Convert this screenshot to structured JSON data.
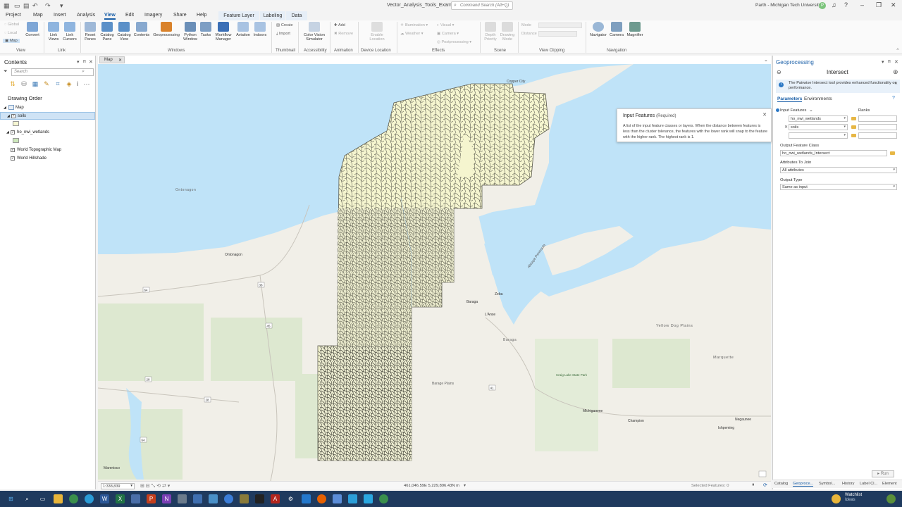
{
  "titlebar": {
    "doc_title": "Vector_Analysis_Tools_Examples",
    "search_placeholder": "Command Search (Alt+Q)",
    "user": "Parth - Michigan Tech University",
    "avatar_initial": "P"
  },
  "menu_tabs": [
    "Project",
    "Map",
    "Insert",
    "Analysis",
    "View",
    "Edit",
    "Imagery",
    "Share",
    "Help"
  ],
  "active_tab": "View",
  "context_tabs": [
    "Feature Layer",
    "Labeling",
    "Data"
  ],
  "ribbon": {
    "view_group": {
      "global": "Global",
      "local": "Local",
      "map": "Map",
      "convert": "Convert",
      "label": "View"
    },
    "link_group": {
      "link_views": "Link Views",
      "link_cursors": "Link Cursors",
      "label": "Link"
    },
    "windows_group": {
      "items": [
        "Reset Panes",
        "Catalog Pane",
        "Catalog View",
        "Contents",
        "Geoprocessing",
        "Python Window",
        "Tasks",
        "Workflow Manager",
        "Aviation",
        "Indoors"
      ],
      "label": "Windows"
    },
    "thumbnail_group": {
      "create": "Create",
      "import": "Import",
      "label": "Thumbnail"
    },
    "accessibility_group": {
      "item": "Color Vision Simulator",
      "label": "Accessibility"
    },
    "animation_group": {
      "add": "Add",
      "remove": "Remove",
      "label": "Animation"
    },
    "device_location_group": {
      "item": "Enable Location",
      "label": "Device Location"
    },
    "effects_group": {
      "items": [
        "Illumination",
        "Weather",
        "Visual",
        "Camera",
        "Postprocessing"
      ],
      "label": "Effects"
    },
    "scene_group": {
      "items": [
        "Depth Priority",
        "Drawing Mode"
      ],
      "label": "Scene"
    },
    "view_clipping_group": {
      "mode": "Mode",
      "distance": "Distance",
      "label": "View Clipping"
    },
    "navigation_group": {
      "items": [
        "Navigator",
        "Camera",
        "Magnifier"
      ],
      "label": "Navigation"
    }
  },
  "contents": {
    "title": "Contents",
    "search_placeholder": "Search",
    "drawing_order": "Drawing Order",
    "layers": [
      {
        "name": "Map"
      },
      {
        "name": "soils"
      },
      {
        "name": "ho_nwi_wetlands"
      },
      {
        "name": "World Topographic Map"
      },
      {
        "name": "World Hillshade"
      }
    ],
    "colors": {
      "soils": "#f6f6d2",
      "wetlands": "#cde8bb"
    }
  },
  "map": {
    "tab_label": "Map",
    "scale": "1:338,839",
    "coords": "461,046.59E 5,229,896.43N m",
    "selected_features": "Selected Features: 0",
    "places": [
      "Copper City",
      "Ontonagon",
      "Ontonagon",
      "Zeba",
      "Baraga",
      "L'Anse",
      "Baraga",
      "Yellow Dog Plains",
      "Marquette",
      "Barage Plains",
      "Craig Lake State Park",
      "Michigamme",
      "Champion",
      "Ishpeming",
      "Negaunee",
      "Marenisco",
      "Abbaye Peninsula"
    ],
    "roads": [
      "64",
      "38",
      "45",
      "28",
      "28",
      "64",
      "41"
    ],
    "colors": {
      "water": "#bfe3f8",
      "land": "#f1efe8",
      "forest": "#dde8d0",
      "soil": "#f5f5cf"
    }
  },
  "geoprocessing": {
    "title": "Geoprocessing",
    "tool": "Intersect",
    "info_text": "The Pairwise Intersect tool provides enhanced functionality or performance.",
    "info_link": "Pairwise Intersect",
    "tabs": [
      "Parameters",
      "Environments"
    ],
    "input_label": "Input Features",
    "ranks_label": "Ranks",
    "inputs": [
      "ho_nwi_wetlands",
      "soils",
      ""
    ],
    "output_label": "Output Feature Class",
    "output_value": "ho_nwi_wetlands_Intersect",
    "attributes_label": "Attributes To Join",
    "attributes_value": "All attributes",
    "output_type_label": "Output Type",
    "output_type_value": "Same as input",
    "run": "Run",
    "tooltip": {
      "title": "Input Features",
      "req": "(Required)",
      "body": "A list of the input feature classes or layers. When the distance between features is less than the cluster tolerance, the features with the lower rank will snap to the feature with the higher rank. The highest rank is 1."
    }
  },
  "bottom_tabs": [
    "Catalog",
    "Geoproce...",
    "Symbol...",
    "History",
    "Label Cl...",
    "Element"
  ],
  "taskbar": {
    "watchlist": "Watchlist",
    "ideas": "Ideas"
  }
}
